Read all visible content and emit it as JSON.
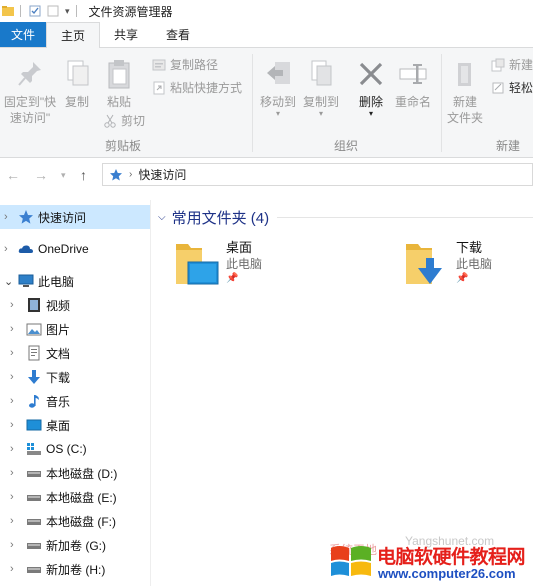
{
  "window": {
    "title": "文件资源管理器",
    "quick_access_toolbar": [
      "folder-icon",
      "properties-icon",
      "new-folder-icon",
      "customize-dropdown"
    ]
  },
  "tabs": [
    {
      "label": "文件",
      "state": "file"
    },
    {
      "label": "主页",
      "state": "active"
    },
    {
      "label": "共享",
      "state": "normal"
    },
    {
      "label": "查看",
      "state": "normal"
    }
  ],
  "ribbon": {
    "clipboard": {
      "group_label": "剪贴板",
      "pin": "固定到\"快速访问\"",
      "copy": "复制",
      "paste": "粘贴",
      "copy_path": "复制路径",
      "paste_shortcut": "粘贴快捷方式",
      "cut": "剪切"
    },
    "organize": {
      "group_label": "组织",
      "move_to": "移动到",
      "copy_to": "复制到",
      "delete": "删除",
      "rename": "重命名"
    },
    "new": {
      "group_label": "新建",
      "new_folder": "新建\n文件夹",
      "new_item": "新建",
      "easy_access": "轻松"
    }
  },
  "address_bar": {
    "path_sep": "›",
    "location": "快速访问"
  },
  "sidebar": {
    "items": [
      {
        "label": "快速访问",
        "icon": "star-icon",
        "selected": true
      },
      {
        "label": "OneDrive",
        "icon": "cloud-icon"
      },
      {
        "label": "此电脑",
        "icon": "computer-icon",
        "expanded": true
      },
      {
        "label": "视频",
        "icon": "video-icon"
      },
      {
        "label": "图片",
        "icon": "picture-icon"
      },
      {
        "label": "文档",
        "icon": "document-icon"
      },
      {
        "label": "下载",
        "icon": "download-icon"
      },
      {
        "label": "音乐",
        "icon": "music-icon"
      },
      {
        "label": "桌面",
        "icon": "desktop-icon"
      },
      {
        "label": "OS (C:)",
        "icon": "os-drive-icon"
      },
      {
        "label": "本地磁盘 (D:)",
        "icon": "drive-icon"
      },
      {
        "label": "本地磁盘 (E:)",
        "icon": "drive-icon"
      },
      {
        "label": "本地磁盘 (F:)",
        "icon": "drive-icon"
      },
      {
        "label": "新加卷 (G:)",
        "icon": "drive-icon"
      },
      {
        "label": "新加卷 (H:)",
        "icon": "drive-icon"
      }
    ]
  },
  "content": {
    "section_title": "常用文件夹 (4)",
    "folders": [
      {
        "name": "桌面",
        "location": "此电脑"
      },
      {
        "name": "下载",
        "location": "此电脑"
      }
    ]
  },
  "watermark": {
    "title": "电脑软硬件教程网",
    "url": "www.computer26.com",
    "faint_text": "Yangshunet.com",
    "faint_text2": "系统天地"
  },
  "colors": {
    "accent": "#1979ca",
    "selection": "#cce8ff",
    "section_title": "#1e3287",
    "folder_yellow": "#f3c54b",
    "watermark_red": "#e5201b",
    "watermark_blue": "#1d4fc1"
  }
}
